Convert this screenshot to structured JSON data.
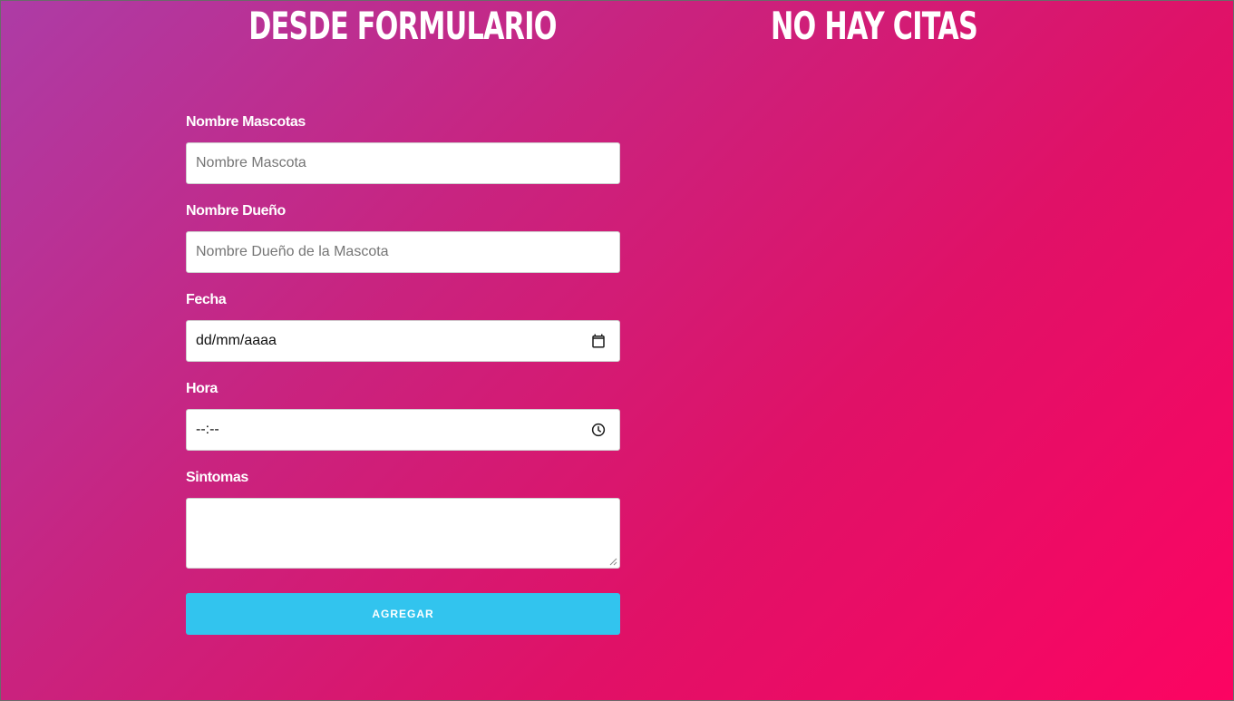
{
  "form_section": {
    "heading": "DESDE FORMULARIO"
  },
  "appointments_section": {
    "heading": "NO HAY CITAS"
  },
  "form": {
    "pet_name": {
      "label": "Nombre Mascotas",
      "placeholder": "Nombre Mascota",
      "value": ""
    },
    "owner_name": {
      "label": "Nombre Dueño",
      "placeholder": "Nombre Dueño de la Mascota",
      "value": ""
    },
    "date": {
      "label": "Fecha",
      "display": "dd/mm/aaaa",
      "icon": "calendar-icon"
    },
    "time": {
      "label": "Hora",
      "display": "--:--",
      "icon": "clock-icon"
    },
    "symptoms": {
      "label": "Sintomas",
      "value": ""
    },
    "submit_label": "AGREGAR"
  },
  "colors": {
    "gradient_start": "#ad3ca6",
    "gradient_end": "#fc0462",
    "button": "#32c4ee",
    "text": "#ffffff"
  }
}
